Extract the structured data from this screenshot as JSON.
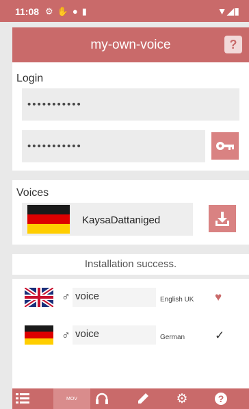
{
  "status_bar": {
    "time": "11:08",
    "icons": [
      "gear-icon",
      "hand-icon",
      "location-icon",
      "sd-card-icon"
    ],
    "right_icons": [
      "wifi-icon",
      "signal-icon",
      "battery-icon"
    ]
  },
  "header": {
    "title": "my-own-voice",
    "help_icon": "question-icon"
  },
  "login": {
    "label": "Login",
    "username_value": "•••••••••••",
    "password_value": "•••••••••••"
  },
  "voices": {
    "label": "Voices",
    "selected_voice": "KaysaDattaniged",
    "selected_flag": "german-flag"
  },
  "status_message": "Installation success.",
  "voice_list": [
    {
      "flag": "uk-flag",
      "symbol": "♂",
      "name": "voice",
      "language": "English UK",
      "action": "heart-icon"
    },
    {
      "flag": "german-flag",
      "symbol": "♂",
      "name": "voice",
      "language": "German",
      "action": "check-icon"
    }
  ],
  "bottom_nav": {
    "items": [
      "list-icon",
      "mov-tab",
      "headphones-icon",
      "pencil-icon",
      "gear-icon",
      "help-icon"
    ],
    "mov_label": "MOV"
  },
  "colors": {
    "accent": "#c96a6a",
    "accent_light": "#d98282",
    "background": "#e9e9e9"
  }
}
